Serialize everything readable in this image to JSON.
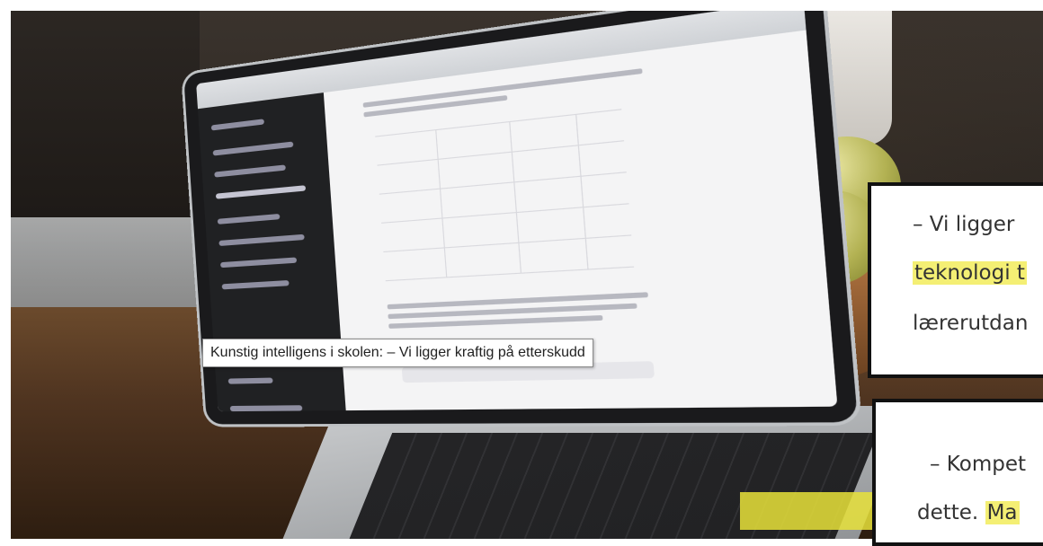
{
  "tooltip": {
    "text": "Kunstig intelligens i skolen: – Vi ligger kraftig på etterskudd"
  },
  "zoom_card_1": {
    "line1": "– Vi ligger ",
    "line2_highlight": "teknologi t",
    "line3": "lærerutdan"
  },
  "zoom_card_2": {
    "line1": "– Kompet",
    "line2_prefix": "dette. ",
    "line2_highlight": "Ma"
  },
  "colors": {
    "highlight": "#f4ef74",
    "card_border": "#111111",
    "tooltip_border": "#8a8a8a"
  }
}
